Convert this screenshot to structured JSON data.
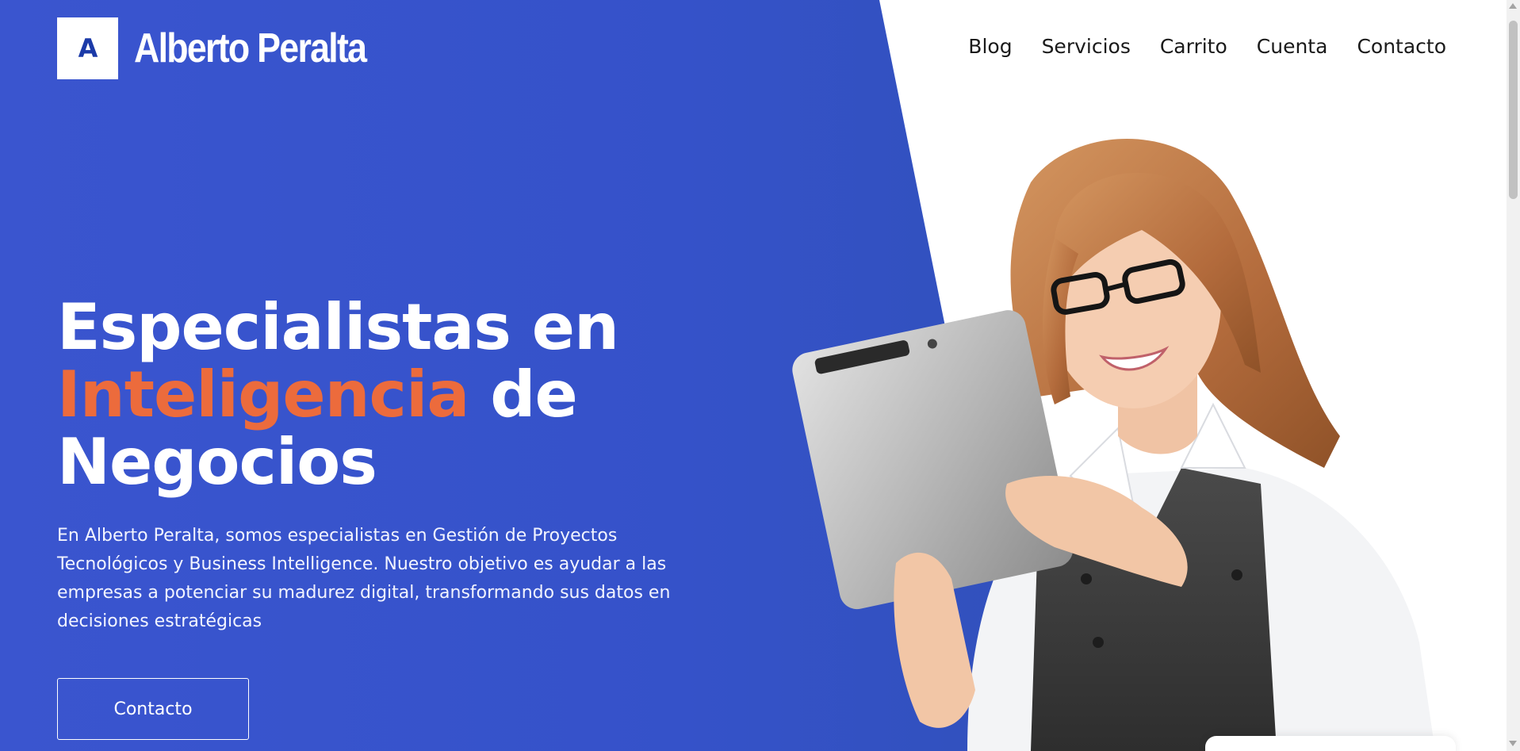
{
  "brand": {
    "logo_mark": "A",
    "name": "Alberto Peralta",
    "mark_color": "#1b3aa8"
  },
  "nav": {
    "items": [
      {
        "label": "Blog"
      },
      {
        "label": "Servicios"
      },
      {
        "label": "Carrito"
      },
      {
        "label": "Cuenta"
      },
      {
        "label": "Contacto"
      }
    ]
  },
  "hero": {
    "headline_part1": "Especialistas en",
    "headline_accent": "Inteligencia",
    "headline_part2": "de",
    "headline_part3": "Negocios",
    "description": "En Alberto Peralta, somos especialistas en Gestión de Proyectos Tecnológicos y Business Intelligence. Nuestro objetivo es ayudar a las empresas a potenciar su madurez digital, transformando sus datos en decisiones estratégicas",
    "cta_label": "Contacto",
    "image_icon": "woman-with-tablet-photo"
  },
  "colors": {
    "hero_blue": "#3552c9",
    "accent_orange": "#ec6b3c",
    "text_white": "#ffffff",
    "nav_text": "#1a1a1a"
  }
}
